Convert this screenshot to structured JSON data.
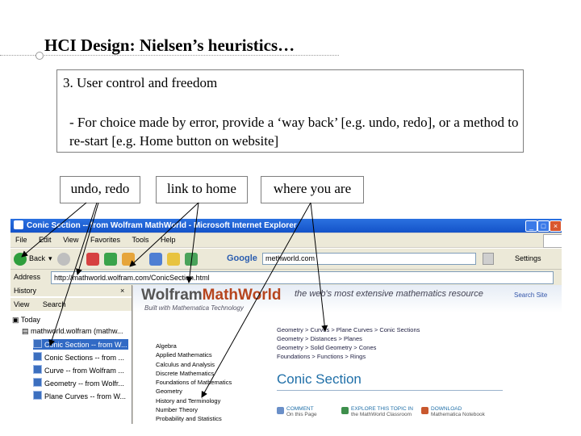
{
  "slide": {
    "title": "HCI Design: Nielsen’s heuristics…",
    "heuristic_heading": "3. User control and freedom",
    "heuristic_body": "- For choice made by error, provide a ‘way back’ [e.g. undo, redo], or a method to re-start [e.g. Home button on website]",
    "callouts": {
      "undo_redo": "undo, redo",
      "link_home": "link to home",
      "where_you_are": "where you are"
    }
  },
  "browser": {
    "window_title": "Conic Section -- from Wolfram MathWorld - Microsoft Internet Explorer",
    "menu": [
      "File",
      "Edit",
      "View",
      "Favorites",
      "Tools",
      "Help"
    ],
    "back_label": "Back",
    "google_label": "Google",
    "google_query": "methworld.com",
    "settings_label": "Settings",
    "address_label": "Address",
    "address_value": "http://mathworld.wolfram.com/ConicSection.html",
    "history": {
      "title": "History",
      "view_label": "View",
      "search_label": "Search",
      "today_label": "Today",
      "site_label": "mathworld.wolfram (mathw...",
      "items": [
        "Conic Section -- from W...",
        "Conic Sections -- from ...",
        "Curve -- from Wolfram ...",
        "Geometry -- from Wolfr...",
        "Plane Curves -- from W..."
      ]
    },
    "page": {
      "logo_a": "Wolfram",
      "logo_b": "MathWorld",
      "tagline": "the web's most extensive mathematics resource",
      "built_with": "Built with Mathematica Technology",
      "search_site": "Search Site",
      "nav": [
        "Algebra",
        "Applied Mathematics",
        "Calculus and Analysis",
        "Discrete Mathematics",
        "Foundations of Mathematics",
        "Geometry",
        "History and Terminology",
        "Number Theory",
        "Probability and Statistics"
      ],
      "breadcrumbs": [
        "Geometry > Curves > Plane Curves > Conic Sections",
        "Geometry > Distances > Planes",
        "Geometry > Solid Geometry > Cones",
        "Foundations > Functions > Rings"
      ],
      "heading": "Conic Section",
      "footer_links": [
        [
          "COMMENT",
          "On this Page"
        ],
        [
          "EXPLORE THIS TOPIC IN",
          "the MathWorld Classroom"
        ],
        [
          "DOWNLOAD",
          "Mathematica Notebook"
        ]
      ]
    }
  },
  "colors": {
    "titlebar": "#1453c9",
    "selection": "#316ac5",
    "brand_orange": "#b6451e",
    "heading_blue": "#1f6fa8"
  }
}
